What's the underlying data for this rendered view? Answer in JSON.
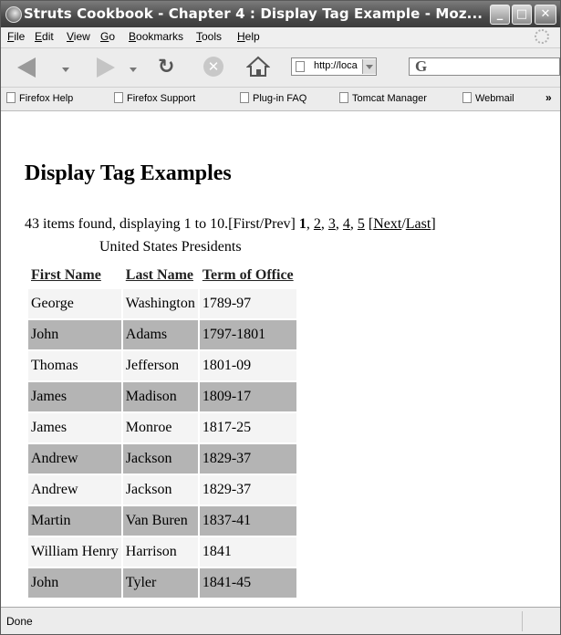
{
  "window": {
    "title": "Struts Cookbook - Chapter 4 : Display Tag Example - Moz...",
    "controls": {
      "minimize": "_",
      "maximize": "□",
      "close": "✕"
    }
  },
  "menubar": {
    "items": [
      "File",
      "Edit",
      "View",
      "Go",
      "Bookmarks",
      "Tools",
      "Help"
    ]
  },
  "navbar": {
    "url": "http://loca",
    "search_icon": "G"
  },
  "bookmarks": {
    "items": [
      "Firefox Help",
      "Firefox Support",
      "Plug-in FAQ",
      "Tomcat Manager",
      "Webmail"
    ],
    "overflow": "»"
  },
  "page": {
    "heading": "Display Tag Examples",
    "banner": {
      "prefix": "43 items found, displaying 1 to 10.",
      "first_prev": "[First/Prev]",
      "current_page": "1",
      "pages": [
        "2",
        "3",
        "4",
        "5"
      ],
      "next": "Next",
      "last": "Last"
    },
    "table": {
      "caption": "United States Presidents",
      "columns": [
        "First Name",
        "Last Name",
        "Term of Office"
      ],
      "rows": [
        [
          "George",
          "Washington",
          "1789-97"
        ],
        [
          "John",
          "Adams",
          "1797-1801"
        ],
        [
          "Thomas",
          "Jefferson",
          "1801-09"
        ],
        [
          "James",
          "Madison",
          "1809-17"
        ],
        [
          "James",
          "Monroe",
          "1817-25"
        ],
        [
          "Andrew",
          "Jackson",
          "1829-37"
        ],
        [
          "Andrew",
          "Jackson",
          "1829-37"
        ],
        [
          "Martin",
          "Van Buren",
          "1837-41"
        ],
        [
          "William Henry",
          "Harrison",
          "1841"
        ],
        [
          "John",
          "Tyler",
          "1841-45"
        ]
      ]
    }
  },
  "statusbar": {
    "text": "Done"
  },
  "icons": {
    "app": "firefox-icon",
    "back": "back-arrow-icon",
    "forward": "forward-arrow-icon",
    "reload": "reload-icon",
    "stop": "stop-icon",
    "home": "home-icon",
    "page": "page-icon",
    "search": "google-search-icon",
    "throbber": "throbber-icon"
  }
}
